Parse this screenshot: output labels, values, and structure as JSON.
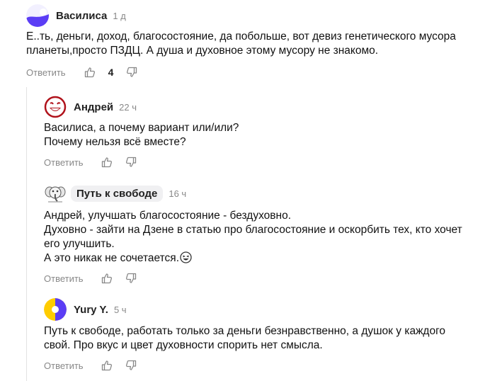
{
  "comments": [
    {
      "author": "Василиса",
      "time": "1 д",
      "avatar_icon": "purple-blob-avatar-icon",
      "lines": [
        "Е..ть, деньги, доход, благосостояние, да побольше, вот девиз генетического мусора",
        "планеты,просто ПЗДЦ. А душа и духовное этому мусору не знакомо."
      ],
      "reply_label": "Ответить",
      "likes": "4"
    },
    {
      "author": "Андрей",
      "time": "22 ч",
      "avatar_icon": "red-smiley-avatar-icon",
      "lines": [
        "Василиса, а почему вариант или/или?",
        "Почему нельзя всё вместе?"
      ],
      "reply_label": "Ответить"
    },
    {
      "author": "Путь к свободе",
      "time": "16 ч",
      "avatar_icon": "elephant-avatar-icon",
      "lines": [
        "Андрей, улучшать благосостояние - бездуховно.",
        "Духовно - зайти на Дзене в статью про благосостояние и оскорбить тех, кто хочет",
        "его улучшить.",
        "А это никак не сочетается."
      ],
      "emoji_icon": "laughing-face-icon",
      "reply_label": "Ответить"
    },
    {
      "author": "Yury Y.",
      "time": "5 ч",
      "avatar_icon": "yellow-purple-avatar-icon",
      "lines": [
        "Путь к свободе, работать только за деньги безнравственно, а душок у каждого",
        "свой. Про вкус и цвет духовности спорить нет смысла."
      ],
      "reply_label": "Ответить"
    }
  ],
  "colors": {
    "muted": "#888888",
    "thread_line": "#e3e3e3",
    "chip_bg": "#f0f0f2",
    "accent_purple": "#5b3df5",
    "accent_yellow": "#ffcc00",
    "avatar_red": "#b0121b"
  }
}
